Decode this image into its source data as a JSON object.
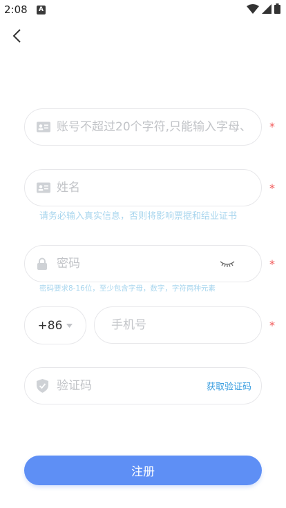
{
  "status_bar": {
    "time": "2:08",
    "app_icon_letter": "A"
  },
  "form": {
    "account": {
      "placeholder": "账号不超过20个字符,只能输入字母、",
      "required": "*"
    },
    "name": {
      "placeholder": "姓名",
      "required": "*",
      "hint": "请务必输入真实信息，否则将影响票据和结业证书"
    },
    "password": {
      "placeholder": "密码",
      "required": "*",
      "hint": "密码要求8-16位，至少包含字母，数字，字符两种元素"
    },
    "phone": {
      "country_code": "+86",
      "placeholder": "手机号",
      "required": "*"
    },
    "verify": {
      "placeholder": "验证码",
      "get_code_label": "获取验证码"
    },
    "register_label": "注册"
  },
  "colors": {
    "accent": "#5e8ff5",
    "hint": "#a9d6ee",
    "required": "#f25a5a",
    "link": "#3a9ee0"
  }
}
